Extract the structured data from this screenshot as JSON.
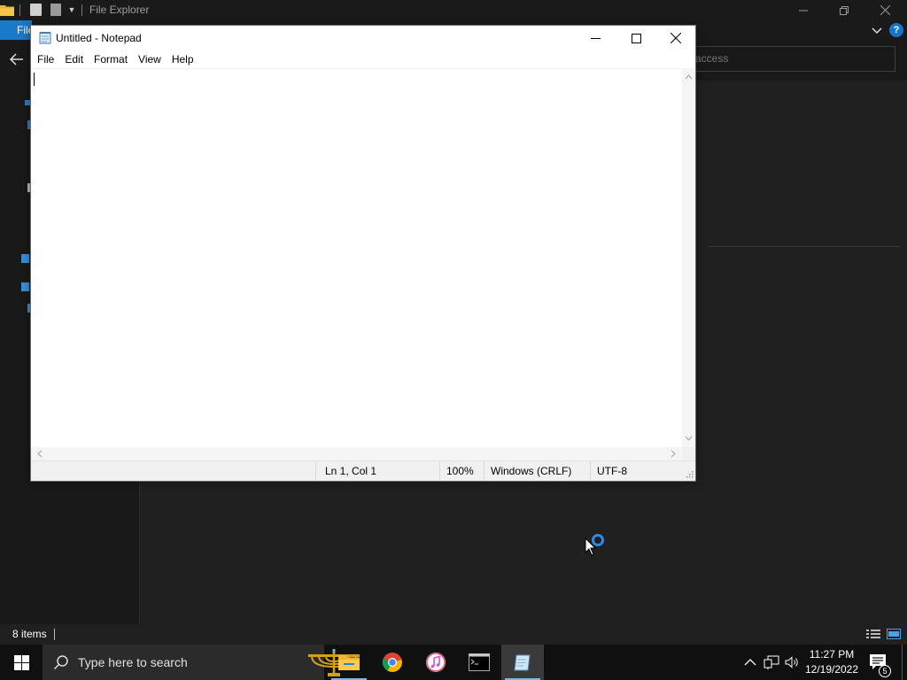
{
  "explorer": {
    "title": "File Explorer",
    "file_tab": "File",
    "search_placeholder": "access",
    "status_count": "8 items"
  },
  "notepad": {
    "title": "Untitled - Notepad",
    "menu": [
      "File",
      "Edit",
      "Format",
      "View",
      "Help"
    ],
    "content": "",
    "status": {
      "position": "Ln 1, Col 1",
      "zoom": "100%",
      "line_ending": "Windows (CRLF)",
      "encoding": "UTF-8"
    }
  },
  "taskbar": {
    "search_placeholder": "Type here to search",
    "apps": [
      {
        "name": "File Explorer",
        "icon": "folder-icon",
        "running": true
      },
      {
        "name": "Google Chrome",
        "icon": "chrome-icon",
        "running": false
      },
      {
        "name": "iTunes",
        "icon": "music-note-icon",
        "running": false
      },
      {
        "name": "Command Prompt",
        "icon": "terminal-icon",
        "running": false
      },
      {
        "name": "Notepad",
        "icon": "notepad-icon",
        "running": true,
        "active": true
      }
    ],
    "time": "11:27 PM",
    "date": "12/19/2022",
    "notification_count": "5"
  },
  "colors": {
    "accent": "#1979ca",
    "taskbar_bg": "#101010",
    "explorer_bg": "#202020",
    "running_indicator": "#76b9ed"
  }
}
